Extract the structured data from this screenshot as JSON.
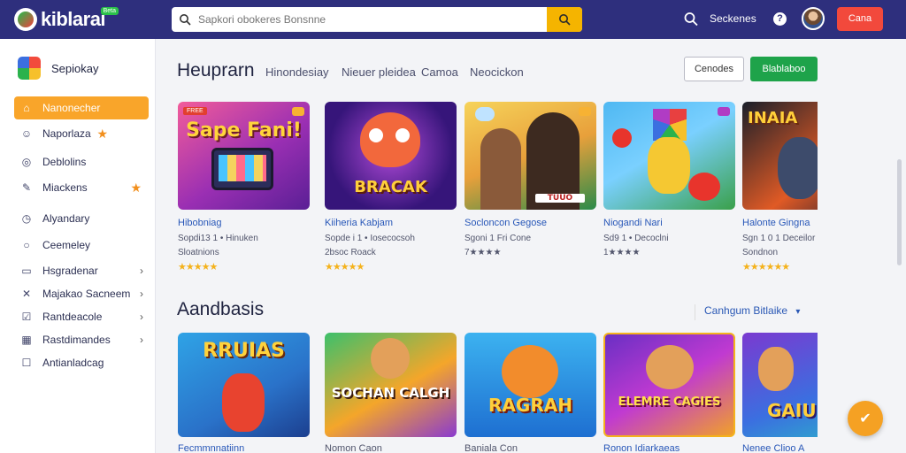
{
  "header": {
    "logo_text": "kiblarai",
    "logo_badge": "Beta",
    "search_placeholder": "Sapkori obokeres Bonsnne",
    "search_link": "Seckenes",
    "help_label": "?",
    "cta_label": "Cana"
  },
  "sidebar": {
    "brand_label": "Sepiokay",
    "items": [
      {
        "label": "Nanonecher",
        "icon": "home-icon"
      },
      {
        "label": "Naporlaza",
        "icon": "people-icon"
      },
      {
        "label": "Deblolins",
        "icon": "compass-icon"
      },
      {
        "label": "Miackens",
        "icon": "edit-icon"
      },
      {
        "label": "Alyandary",
        "icon": "clock-icon"
      },
      {
        "label": "Ceemeley",
        "icon": "circle-icon"
      },
      {
        "label": "Hsgradenar",
        "icon": "book-icon"
      },
      {
        "label": "Majakao Sacneem",
        "icon": "tools-icon"
      },
      {
        "label": "Rantdeacole",
        "icon": "list-icon"
      },
      {
        "label": "Rastdimandes",
        "icon": "grid-icon"
      },
      {
        "label": "Antianladcag",
        "icon": "doc-icon"
      }
    ]
  },
  "main": {
    "section1_title": "Heuprarn",
    "tabs": [
      "Hinondesiay",
      "Nieuer pleidea",
      "Camoa",
      "Neocickon"
    ],
    "outline_button": "Cenodes",
    "green_button": "Blablaboo",
    "row1": [
      {
        "title": "Hibobniag",
        "meta": "Sopdi13 1 • Hinuken",
        "sub": "Sloatnions",
        "stars": "★★★★★",
        "art": "Sape Fani!",
        "tag": "FREE"
      },
      {
        "title": "Kiiheria Kabjam",
        "meta": "Sopde i 1 • Iosecocsoh",
        "sub": "2bsoc Roack",
        "stars": "★★★★★",
        "art": "BRACAK",
        "tag": ""
      },
      {
        "title": "Socloncon Gegose",
        "meta": "Sgoni 1 Fri Cone",
        "sub": "7★★★★",
        "stars": "",
        "art": "TUUO",
        "tag": ""
      },
      {
        "title": "Niogandi Nari",
        "meta": "Sd9 1 • Decoclni",
        "sub": "1★★★★",
        "stars": "",
        "art": "",
        "tag": ""
      },
      {
        "title": "Halonte Gingna",
        "meta": "Sgn 1 0 1 Deceilor",
        "sub": "Sondnon",
        "stars": "★★★★★★",
        "art": "INAIA",
        "tag": ""
      }
    ],
    "section2_title": "Aandbasis",
    "sort_label": "Canhgum Bitlaike",
    "row2": [
      {
        "title": "Fecmmnnatiinn",
        "art": "RRUIAS"
      },
      {
        "title": "Nomon Caon",
        "art": "SOCHAN CALGH"
      },
      {
        "title": "Baniala Con",
        "art": "RAGRAH"
      },
      {
        "title": "Ronon Idiarkaeas",
        "art": "ELEMRE CAGIES"
      },
      {
        "title": "Nenee Clioo A",
        "art": "GAIU"
      }
    ]
  },
  "colors": {
    "topbar": "#2e2f7d",
    "accent": "#f9a52a",
    "green": "#1ea34a",
    "red": "#f2493c"
  }
}
